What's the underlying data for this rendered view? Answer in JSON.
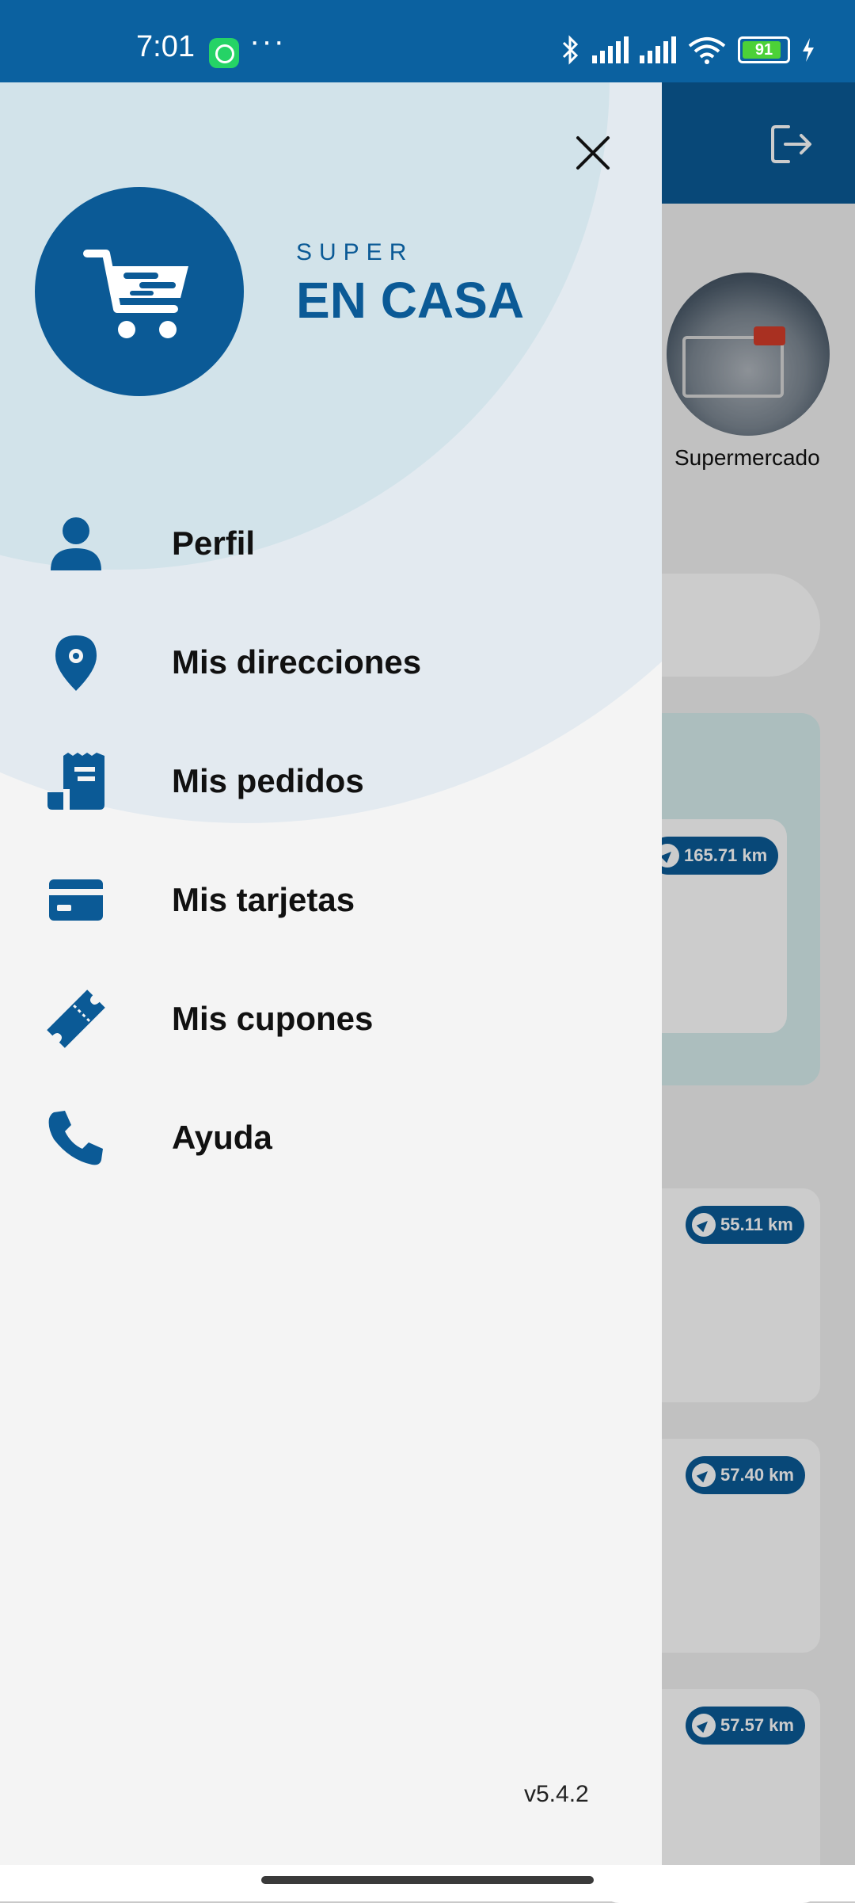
{
  "status_bar": {
    "time": "7:01",
    "battery": "91",
    "colors": {
      "background": "#0b61a0"
    }
  },
  "background_app": {
    "category_label": "Supermercado",
    "distances": [
      "165.71 km",
      "55.11 km",
      "57.40 km",
      "57.57 km"
    ],
    "icons": [
      "logout-icon",
      "navigation-arrow-icon"
    ]
  },
  "drawer": {
    "brand": {
      "line1": "SUPER",
      "line2": "EN CASA",
      "color": "#0b5a96"
    },
    "menu": [
      {
        "label": "Perfil",
        "icon": "person-icon"
      },
      {
        "label": "Mis direcciones",
        "icon": "location-pin-icon"
      },
      {
        "label": "Mis pedidos",
        "icon": "receipt-icon"
      },
      {
        "label": "Mis tarjetas",
        "icon": "credit-card-icon"
      },
      {
        "label": "Mis cupones",
        "icon": "ticket-icon"
      },
      {
        "label": "Ayuda",
        "icon": "phone-icon"
      }
    ],
    "version": "v5.4.2"
  }
}
